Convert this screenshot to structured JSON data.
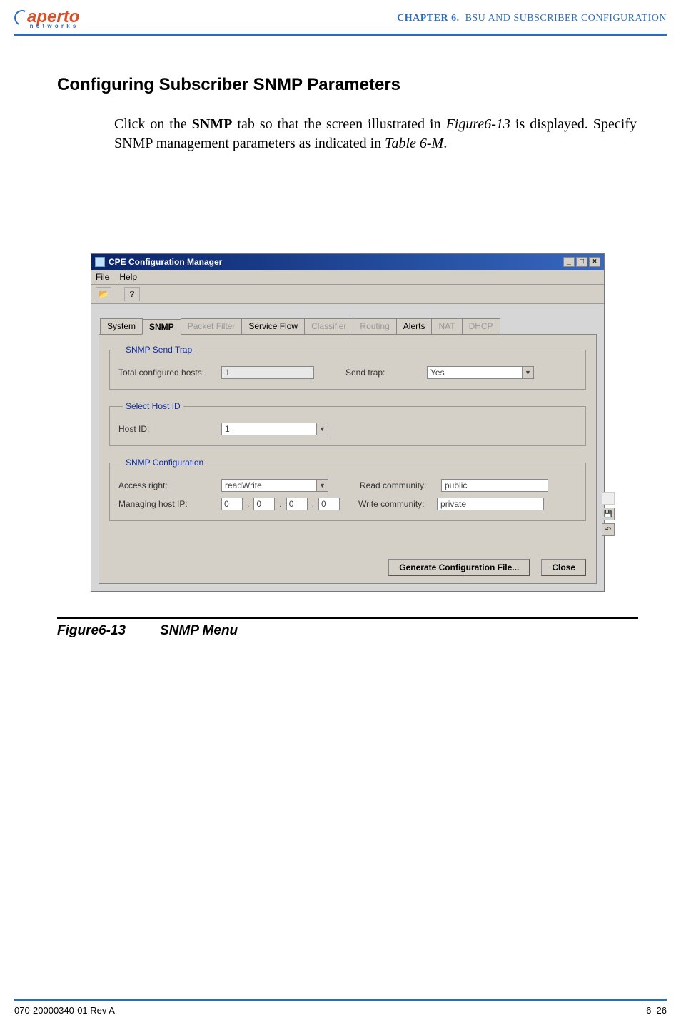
{
  "header": {
    "logo_text": "aperto",
    "logo_sub": "n e t w o r k s",
    "chapter_prefix": "CHAPTER",
    "chapter_num": "6.",
    "chapter_title": "BSU AND SUBSCRIBER CONFIGURATION"
  },
  "section": {
    "title": "Configuring Subscriber SNMP Parameters",
    "body_1": "Click on the ",
    "body_bold": "SNMP",
    "body_2": " tab so that the screen illustrated in ",
    "body_ref1": "Figure6-13",
    "body_3": " is displayed. Specify SNMP management parameters as indicated in ",
    "body_ref2": "Table 6-M",
    "body_end": "."
  },
  "window": {
    "title": "CPE Configuration Manager",
    "menu": {
      "file": "File",
      "help": "Help"
    },
    "toolbar": {
      "open": "📂",
      "help": "?"
    },
    "tabs": [
      "System",
      "SNMP",
      "Packet Filter",
      "Service Flow",
      "Classifier",
      "Routing",
      "Alerts",
      "NAT",
      "DHCP"
    ],
    "disabled_tabs": [
      "Packet Filter",
      "Classifier",
      "Routing",
      "NAT",
      "DHCP"
    ],
    "active_tab": "SNMP",
    "group1": {
      "legend": "SNMP Send Trap",
      "total_hosts_label": "Total configured hosts:",
      "total_hosts_value": "1",
      "send_trap_label": "Send trap:",
      "send_trap_value": "Yes"
    },
    "group2": {
      "legend": "Select Host ID",
      "hostid_label": "Host ID:",
      "hostid_value": "1"
    },
    "group3": {
      "legend": "SNMP Configuration",
      "access_label": "Access right:",
      "access_value": "readWrite",
      "readcomm_label": "Read community:",
      "readcomm_value": "public",
      "mgip_label": "Managing host IP:",
      "ip1": "0",
      "ip2": "0",
      "ip3": "0",
      "ip4": "0",
      "writecomm_label": "Write community:",
      "writecomm_value": "private"
    },
    "buttons": {
      "generate": "Generate Configuration File...",
      "close": "Close"
    },
    "side": {
      "save": "💾",
      "undo": "↶"
    }
  },
  "figure": {
    "num": "Figure6-13",
    "caption": "SNMP Menu"
  },
  "footer": {
    "left": "070-20000340-01 Rev A",
    "right": "6–26"
  }
}
